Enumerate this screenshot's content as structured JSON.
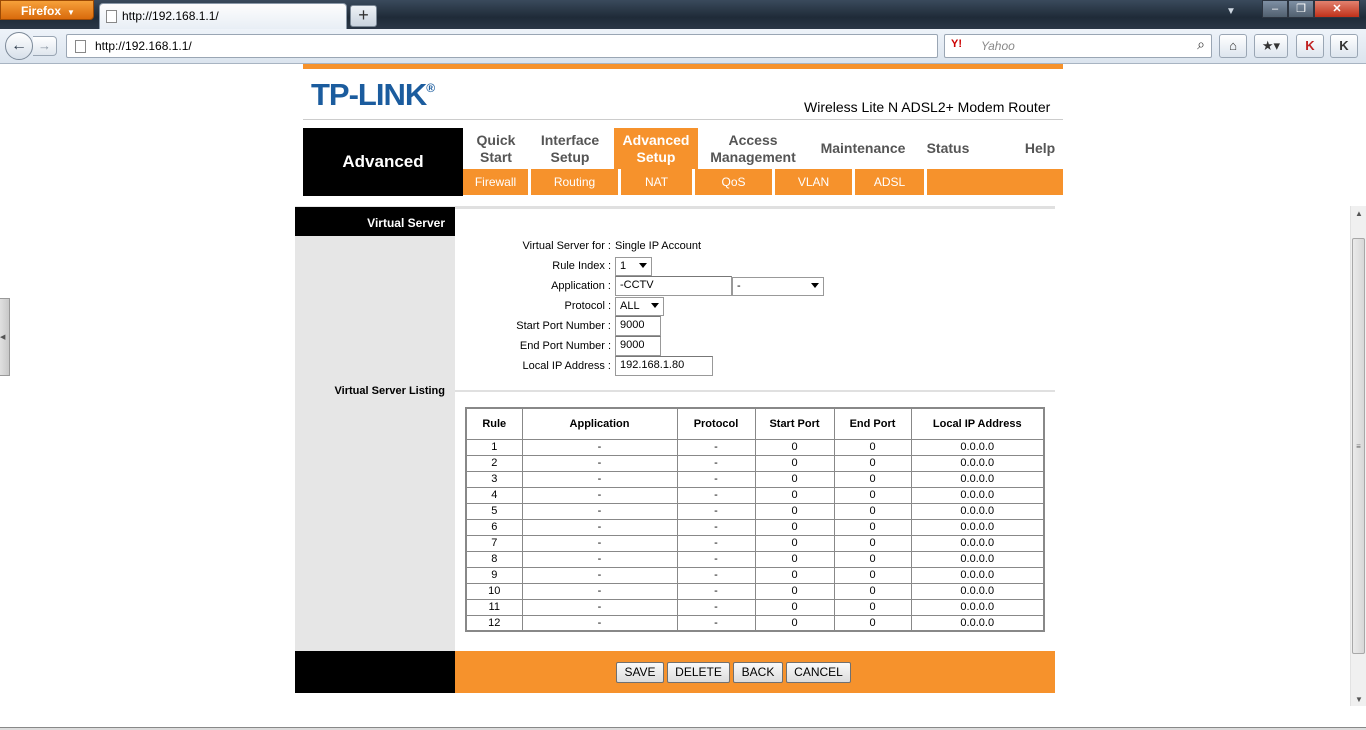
{
  "browser": {
    "menu_button": "Firefox",
    "tab_title": "http://192.168.1.1/",
    "new_tab": "+",
    "url": "http://192.168.1.1/",
    "search_placeholder": "Yahoo",
    "search_engine_icon": "Y!"
  },
  "header": {
    "logo": "TP-LINK",
    "logo_mark": "®",
    "product": "Wireless Lite N ADSL2+ Modem Router"
  },
  "nav": {
    "section_title": "Advanced",
    "main": [
      {
        "label": "Quick\nStart"
      },
      {
        "label": "Interface\nSetup"
      },
      {
        "label": "Advanced\nSetup"
      },
      {
        "label": "Access\nManagement"
      },
      {
        "label": "Maintenance"
      },
      {
        "label": "Status"
      },
      {
        "label": "Help"
      }
    ],
    "active_main": "Advanced Setup",
    "sub": [
      {
        "label": "Firewall"
      },
      {
        "label": "Routing"
      },
      {
        "label": "NAT"
      },
      {
        "label": "QoS"
      },
      {
        "label": "VLAN"
      },
      {
        "label": "ADSL"
      }
    ]
  },
  "virtual_server": {
    "section_label": "Virtual Server",
    "listing_label": "Virtual Server Listing",
    "for_label": "Virtual Server for :",
    "for_value": "Single IP Account",
    "rule_index_label": "Rule Index :",
    "rule_index_value": "1",
    "application_label": "Application :",
    "application_value": "-CCTV",
    "application_preset": "-",
    "protocol_label": "Protocol :",
    "protocol_value": "ALL",
    "start_port_label": "Start Port Number :",
    "start_port_value": "9000",
    "end_port_label": "End Port Number :",
    "end_port_value": "9000",
    "local_ip_label": "Local IP Address :",
    "local_ip_value": "192.168.1.80"
  },
  "table": {
    "headers": [
      "Rule",
      "Application",
      "Protocol",
      "Start Port",
      "End Port",
      "Local IP Address"
    ],
    "rows": [
      [
        "1",
        "-",
        "-",
        "0",
        "0",
        "0.0.0.0"
      ],
      [
        "2",
        "-",
        "-",
        "0",
        "0",
        "0.0.0.0"
      ],
      [
        "3",
        "-",
        "-",
        "0",
        "0",
        "0.0.0.0"
      ],
      [
        "4",
        "-",
        "-",
        "0",
        "0",
        "0.0.0.0"
      ],
      [
        "5",
        "-",
        "-",
        "0",
        "0",
        "0.0.0.0"
      ],
      [
        "6",
        "-",
        "-",
        "0",
        "0",
        "0.0.0.0"
      ],
      [
        "7",
        "-",
        "-",
        "0",
        "0",
        "0.0.0.0"
      ],
      [
        "8",
        "-",
        "-",
        "0",
        "0",
        "0.0.0.0"
      ],
      [
        "9",
        "-",
        "-",
        "0",
        "0",
        "0.0.0.0"
      ],
      [
        "10",
        "-",
        "-",
        "0",
        "0",
        "0.0.0.0"
      ],
      [
        "11",
        "-",
        "-",
        "0",
        "0",
        "0.0.0.0"
      ],
      [
        "12",
        "-",
        "-",
        "0",
        "0",
        "0.0.0.0"
      ]
    ]
  },
  "buttons": {
    "save": "SAVE",
    "delete": "DELETE",
    "back": "BACK",
    "cancel": "CANCEL"
  },
  "colors": {
    "accent": "#f6922c",
    "logo": "#1b5c9e"
  }
}
